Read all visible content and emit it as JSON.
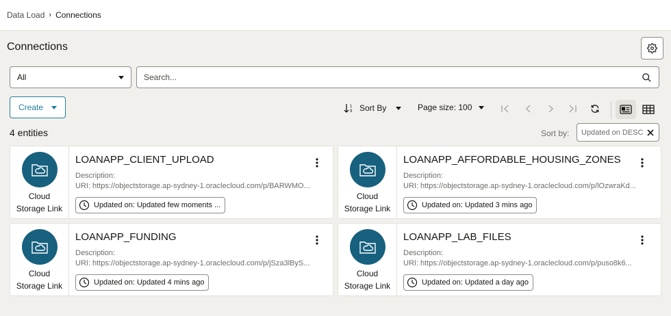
{
  "breadcrumb": {
    "parent": "Data Load",
    "separator": "›",
    "current": "Connections"
  },
  "page": {
    "title": "Connections"
  },
  "filters": {
    "scope_value": "All",
    "search_placeholder": "Search..."
  },
  "toolbar": {
    "create_label": "Create",
    "sort_by_label": "Sort By",
    "page_size_label": "Page size: 100"
  },
  "summary": {
    "entities_count": "4 entities",
    "sort_by_label": "Sort by:",
    "sort_chip": "Updated on DESC"
  },
  "cards": [
    {
      "type_label_1": "Cloud",
      "type_label_2": "Storage Link",
      "name": "LOANAPP_CLIENT_UPLOAD",
      "description": "Description:",
      "uri": "URI: https://objectstorage.ap-sydney-1.oraclecloud.com/p/BARWMO...",
      "updated": "Updated on: Updated few moments ..."
    },
    {
      "type_label_1": "Cloud",
      "type_label_2": "Storage Link",
      "name": "LOANAPP_AFFORDABLE_HOUSING_ZONES",
      "description": "Description:",
      "uri": "URI: https://objectstorage.ap-sydney-1.oraclecloud.com/p/lOzwraKd...",
      "updated": "Updated on: Updated 3 mins ago"
    },
    {
      "type_label_1": "Cloud",
      "type_label_2": "Storage Link",
      "name": "LOANAPP_FUNDING",
      "description": "Description:",
      "uri": "URI: https://objectstorage.ap-sydney-1.oraclecloud.com/p/jSza3lByS...",
      "updated": "Updated on: Updated 4 mins ago"
    },
    {
      "type_label_1": "Cloud",
      "type_label_2": "Storage Link",
      "name": "LOANAPP_LAB_FILES",
      "description": "Description:",
      "uri": "URI: https://objectstorage.ap-sydney-1.oraclecloud.com/p/puso8k6...",
      "updated": "Updated on: Updated a day ago"
    }
  ],
  "icons": {
    "settings": "gear-icon",
    "search": "search-icon",
    "sort": "sort-icon",
    "first_page": "first-page-icon",
    "prev_page": "prev-page-icon",
    "next_page": "next-page-icon",
    "last_page": "last-page-icon",
    "refresh": "refresh-icon",
    "card_view": "card-view-icon",
    "table_view": "table-view-icon",
    "card_type": "cloud-folder-icon",
    "clock": "clock-icon",
    "more": "kebab-icon",
    "clear": "close-icon"
  },
  "colors": {
    "accent": "#227e9e",
    "icon_circle": "#17607e",
    "background": "#f2f0ed"
  }
}
